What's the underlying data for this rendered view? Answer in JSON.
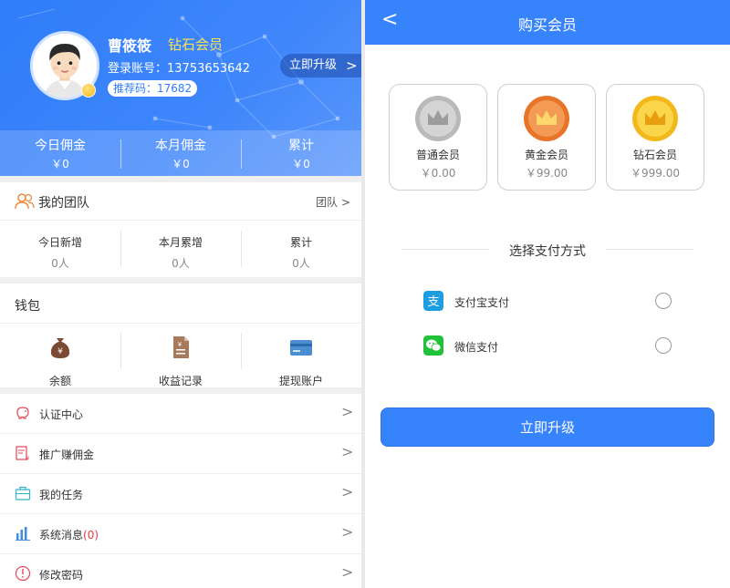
{
  "profile": {
    "name": "曹筱筱",
    "level": "钻石会员",
    "account_label": "登录账号：",
    "account": "13753653642",
    "ref_label": "推荐码：",
    "ref_code": "17682",
    "upgrade_label": "立即升级"
  },
  "stats": [
    {
      "label": "今日佣金",
      "value": "￥0"
    },
    {
      "label": "本月佣金",
      "value": "￥0"
    },
    {
      "label": "累计",
      "value": "￥0"
    }
  ],
  "team": {
    "title": "我的团队",
    "more": "团队",
    "cells": [
      {
        "label": "今日新增",
        "value": "0人"
      },
      {
        "label": "本月累增",
        "value": "0人"
      },
      {
        "label": "累计",
        "value": "0人"
      }
    ]
  },
  "wallet": {
    "title": "钱包",
    "items": [
      {
        "label": "余额",
        "icon": "money-bag-icon"
      },
      {
        "label": "收益记录",
        "icon": "document-icon"
      },
      {
        "label": "提现账户",
        "icon": "card-icon"
      }
    ]
  },
  "menu": [
    {
      "label": "认证中心",
      "badge": "",
      "icon": "piggy-bank-icon"
    },
    {
      "label": "推广赚佣金",
      "badge": "",
      "icon": "promotion-icon"
    },
    {
      "label": "我的任务",
      "badge": "",
      "icon": "briefcase-icon"
    },
    {
      "label": "系统消息",
      "badge": "(0)",
      "icon": "bar-chart-icon"
    },
    {
      "label": "修改密码",
      "badge": "",
      "icon": "info-circle-icon"
    }
  ],
  "purchase": {
    "title": "购买会员",
    "tiers": [
      {
        "name": "普通会员",
        "price": "￥0.00",
        "color": "#b9b9b9"
      },
      {
        "name": "黄金会员",
        "price": "￥99.00",
        "color": "#f0843a"
      },
      {
        "name": "钻石会员",
        "price": "￥999.00",
        "color": "#f5c52a"
      }
    ],
    "pay_section_title": "选择支付方式",
    "pay_methods": [
      {
        "label": "支付宝支付",
        "icon": "alipay-icon",
        "color": "#1d9ee0"
      },
      {
        "label": "微信支付",
        "icon": "wechat-icon",
        "color": "#22c13a"
      }
    ],
    "submit_label": "立即升级"
  },
  "colors": {
    "primary": "#3783fb",
    "level_text": "#f9e05a",
    "badge_red": "#e63b3b"
  }
}
